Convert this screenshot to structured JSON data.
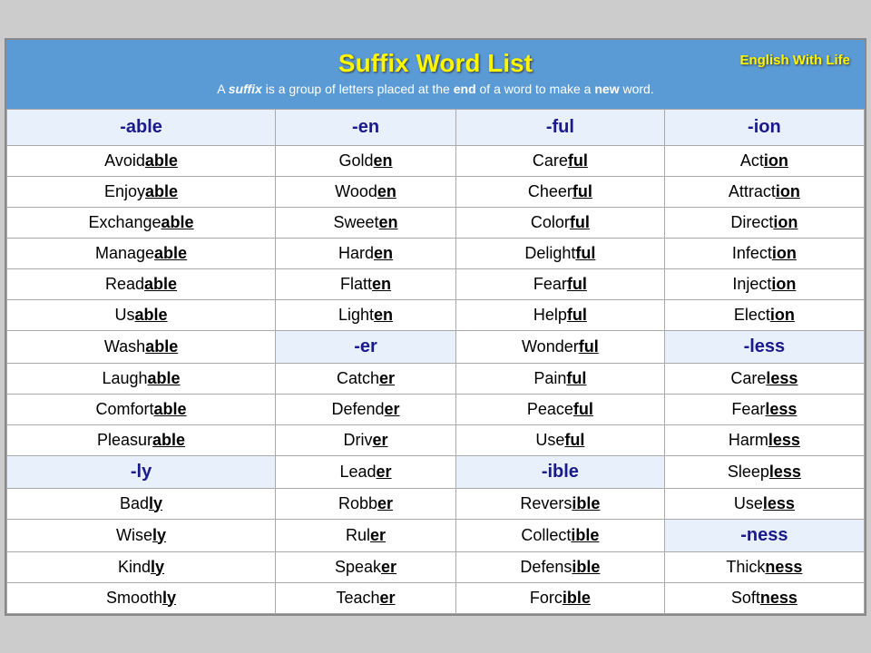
{
  "header": {
    "title": "Suffix Word List",
    "subtitle_pre": "A ",
    "subtitle_suffix": "suffix",
    "subtitle_mid": " is a group of letters placed at the ",
    "subtitle_end": "end",
    "subtitle_mid2": " of a word to make a ",
    "subtitle_new": "new",
    "subtitle_post": " word.",
    "brand": "English With Life"
  },
  "columns": [
    "-able",
    "-en",
    "-ful",
    "-ion"
  ],
  "rows": [
    [
      {
        "base": "Avoidable",
        "suffix": "able"
      },
      {
        "base": "Golden",
        "suffix": "en"
      },
      {
        "base": "Careful",
        "suffix": "ful"
      },
      {
        "base": "Action",
        "suffix": "ion"
      }
    ],
    [
      {
        "base": "Enjoyable",
        "suffix": "able"
      },
      {
        "base": "Wooden",
        "suffix": "en"
      },
      {
        "base": "Cheerful",
        "suffix": "ful"
      },
      {
        "base": "Attraction",
        "suffix": "ion"
      }
    ],
    [
      {
        "base": "Exchangeable",
        "suffix": "able"
      },
      {
        "base": "Sweeten",
        "suffix": "en"
      },
      {
        "base": "Colorful",
        "suffix": "ful"
      },
      {
        "base": "Direction",
        "suffix": "ion"
      }
    ],
    [
      {
        "base": "Manageable",
        "suffix": "able"
      },
      {
        "base": "Harden",
        "suffix": "en"
      },
      {
        "base": "Delightful",
        "suffix": "ful"
      },
      {
        "base": "Infection",
        "suffix": "ion"
      }
    ],
    [
      {
        "base": "Readable",
        "suffix": "able"
      },
      {
        "base": "Flatten",
        "suffix": "en"
      },
      {
        "base": "Fearful",
        "suffix": "ful"
      },
      {
        "base": "Injection",
        "suffix": "ion"
      }
    ],
    [
      {
        "base": "Usable",
        "suffix": "able"
      },
      {
        "base": "Lighten",
        "suffix": "en"
      },
      {
        "base": "Helpful",
        "suffix": "ful"
      },
      {
        "base": "Election",
        "suffix": "ion"
      }
    ],
    [
      {
        "base": "Washable",
        "suffix": "able",
        "section_start": true
      },
      {
        "base": "-er",
        "suffix_header": true
      },
      {
        "base": "Wonderful",
        "suffix": "ful"
      },
      {
        "base": "-less",
        "suffix_header": true
      }
    ],
    [
      {
        "base": "Laughable",
        "suffix": "able"
      },
      {
        "base": "Catcher",
        "suffix": "er"
      },
      {
        "base": "Painful",
        "suffix": "ful"
      },
      {
        "base": "Careless",
        "suffix": "less"
      }
    ],
    [
      {
        "base": "Comfortable",
        "suffix": "able"
      },
      {
        "base": "Defender",
        "suffix": "er"
      },
      {
        "base": "Peaceful",
        "suffix": "ful"
      },
      {
        "base": "Fearless",
        "suffix": "less"
      }
    ],
    [
      {
        "base": "Pleasurable",
        "suffix": "able"
      },
      {
        "base": "Driver",
        "suffix": "er"
      },
      {
        "base": "Useful",
        "suffix": "ful"
      },
      {
        "base": "Harmless",
        "suffix": "less"
      }
    ],
    [
      {
        "base": "-ly",
        "suffix_header": true
      },
      {
        "base": "Leader",
        "suffix": "er"
      },
      {
        "base": "-ible",
        "suffix_header": true
      },
      {
        "base": "Sleepless",
        "suffix": "less"
      }
    ],
    [
      {
        "base": "Badly",
        "suffix": "ly"
      },
      {
        "base": "Robber",
        "suffix": "er"
      },
      {
        "base": "Reversible",
        "suffix": "ible"
      },
      {
        "base": "Useless",
        "suffix": "less"
      }
    ],
    [
      {
        "base": "Wisely",
        "suffix": "ly"
      },
      {
        "base": "Ruler",
        "suffix": "er"
      },
      {
        "base": "Collectible",
        "suffix": "ible"
      },
      {
        "base": "-ness",
        "suffix_header": true
      }
    ],
    [
      {
        "base": "Kindly",
        "suffix": "ly"
      },
      {
        "base": "Speaker",
        "suffix": "er"
      },
      {
        "base": "Defensible",
        "suffix": "ible"
      },
      {
        "base": "Thickness",
        "suffix": "ness"
      }
    ],
    [
      {
        "base": "Smoothly",
        "suffix": "ly"
      },
      {
        "base": "Teacher",
        "suffix": "er"
      },
      {
        "base": "Forcible",
        "suffix": "ible"
      },
      {
        "base": "Softness",
        "suffix": "ness"
      }
    ]
  ]
}
